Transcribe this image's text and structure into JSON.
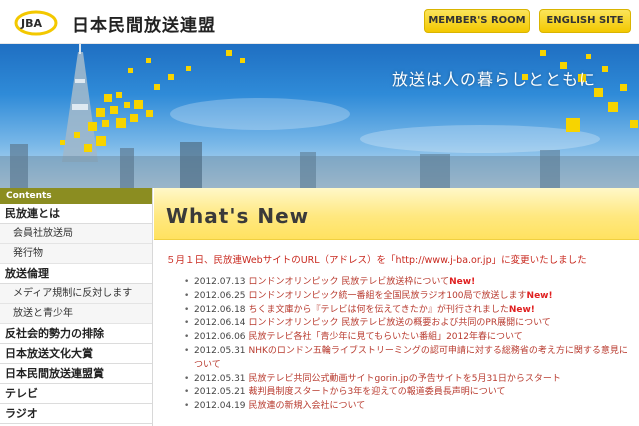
{
  "header": {
    "logo_text": "日本民間放送連盟",
    "logo_mark": "JBA",
    "member_room_label": "MEMBER'S ROOM",
    "english_site_label": "ENGLISH SITE"
  },
  "banner": {
    "tagline": "放送は人の暮らしとともに"
  },
  "sidebar": {
    "header": "Contents",
    "items": [
      {
        "label": "民放連とは",
        "level": "main"
      },
      {
        "label": "会員社放送局",
        "level": "sub"
      },
      {
        "label": "発行物",
        "level": "sub"
      },
      {
        "label": "放送倫理",
        "level": "main"
      },
      {
        "label": "メディア規制に反対します",
        "level": "sub"
      },
      {
        "label": "放送と青少年",
        "level": "sub"
      },
      {
        "label": "反社会的勢力の排除",
        "level": "main"
      },
      {
        "label": "日本放送文化大賞",
        "level": "main"
      },
      {
        "label": "日本民間放送連盟賞",
        "level": "main"
      },
      {
        "label": "テレビ",
        "level": "main"
      },
      {
        "label": "ラジオ",
        "level": "main"
      }
    ]
  },
  "main": {
    "title": "What's New",
    "notice": "５月１日、民放連WebサイトのURL（アドレス）を「http://www.j-ba.or.jp」に変更いたしました",
    "news": [
      {
        "date": "2012.07.13",
        "title": "ロンドンオリンピック 民放テレビ放送枠について",
        "new": "New!"
      },
      {
        "date": "2012.06.25",
        "title": "ロンドンオリンピック統一番組を全国民放ラジオ100局で放送します",
        "new": "New!"
      },
      {
        "date": "2012.06.18",
        "title": "ちくま文庫から『テレビは何を伝えてきたか』が刊行されました",
        "new": "New!"
      },
      {
        "date": "2012.06.14",
        "title": "ロンドンオリンピック 民放テレビ放送の概要および共同のPR展開について",
        "new": ""
      },
      {
        "date": "2012.06.06",
        "title": "民放テレビ各社「青少年に見てもらいたい番組」2012年春について",
        "new": ""
      },
      {
        "date": "2012.05.31",
        "title": "NHKのロンドン五輪ライブストリーミングの認可申請に対する総務省の考え方に関する意見について",
        "new": ""
      },
      {
        "date": "2012.05.31",
        "title": "民放テレビ共同公式動画サイトgorin.jpの予告サイトを5月31日からスタート",
        "new": ""
      },
      {
        "date": "2012.05.21",
        "title": "裁判員制度スタートから3年を迎えての報道委員長声明について",
        "new": ""
      },
      {
        "date": "2012.04.19",
        "title": "民放連の新規入会社について",
        "new": ""
      }
    ]
  },
  "colors": {
    "accent_yellow": "#f3c800",
    "sidebar_header": "#8b8d21",
    "notice_red": "#c8281e"
  }
}
